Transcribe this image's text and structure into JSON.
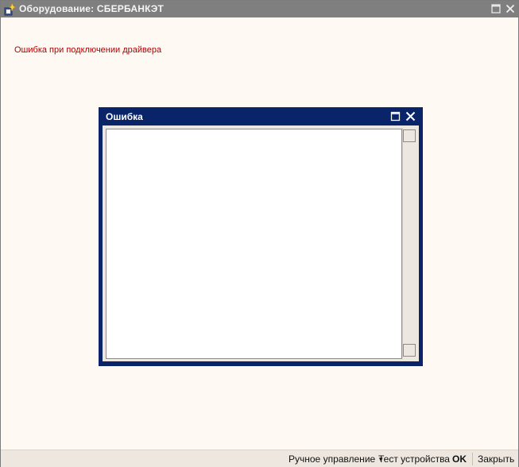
{
  "window": {
    "title": "Оборудование: СБЕРБАНКЭТ",
    "icons": {
      "app": "app-icon",
      "maximize": "maximize-icon",
      "close": "close-icon"
    }
  },
  "main": {
    "error_text": "Ошибка при подключении драйвера"
  },
  "dialog": {
    "title": "Ошибка",
    "text": "",
    "colors": {
      "title_bar": "#0a246a"
    }
  },
  "commands": {
    "manual_control": "Ручное управление",
    "test_device": "Тест устройства",
    "ok": "OK",
    "close": "Закрыть"
  },
  "colors": {
    "error_text": "#b00000",
    "window_title_bar": "#7f7f7f",
    "background": "#fff9f4"
  }
}
